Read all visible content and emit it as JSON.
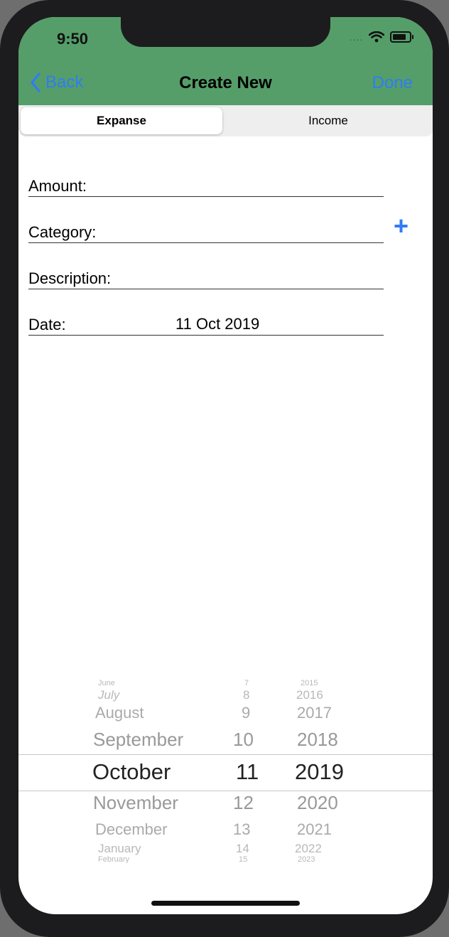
{
  "status_bar": {
    "time": "9:50",
    "signal": "....",
    "wifi_icon": "wifi-icon",
    "battery_icon": "battery-icon"
  },
  "nav": {
    "back_label": "Back",
    "title": "Create New",
    "done_label": "Done"
  },
  "segments": {
    "expense": "Expanse",
    "income": "Income",
    "selected": "Expanse"
  },
  "form": {
    "amount_label": "Amount:",
    "category_label": "Category:",
    "description_label": "Description:",
    "date_label": "Date:",
    "date_value": "11 Oct 2019",
    "add_category_icon": "plus-icon"
  },
  "picker": {
    "months": [
      "June",
      "July",
      "August",
      "September",
      "October",
      "November",
      "December",
      "January",
      "February"
    ],
    "days": [
      "7",
      "8",
      "9",
      "10",
      "11",
      "12",
      "13",
      "14",
      "15"
    ],
    "years": [
      "2015",
      "2016",
      "2017",
      "2018",
      "2019",
      "2020",
      "2021",
      "2022",
      "2023"
    ],
    "selected": {
      "month": "October",
      "day": "11",
      "year": "2019"
    }
  },
  "colors": {
    "header": "#559e69",
    "accent": "#2f7cf6"
  }
}
